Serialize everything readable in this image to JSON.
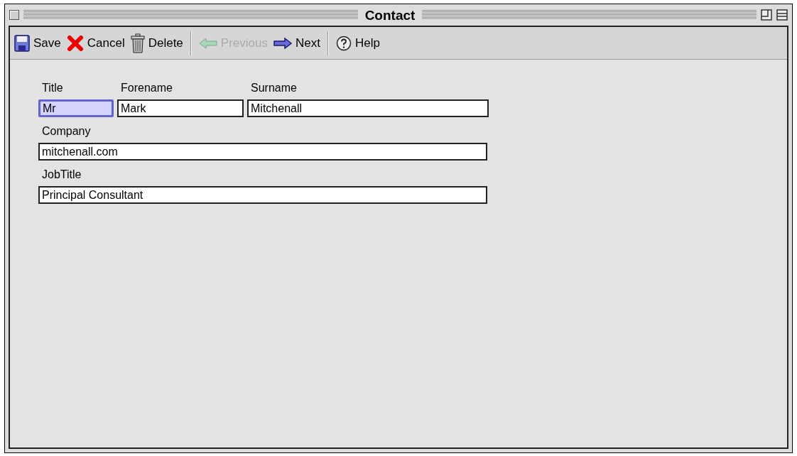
{
  "window": {
    "title": "Contact"
  },
  "toolbar": [
    {
      "kind": "save",
      "label": "Save",
      "disabled": false
    },
    {
      "kind": "cancel",
      "label": "Cancel",
      "disabled": false
    },
    {
      "kind": "delete",
      "label": "Delete",
      "disabled": false
    },
    {
      "kind": "separator"
    },
    {
      "kind": "previous",
      "label": "Previous",
      "disabled": true
    },
    {
      "kind": "next",
      "label": "Next",
      "disabled": false
    },
    {
      "kind": "separator"
    },
    {
      "kind": "help",
      "label": "Help",
      "disabled": false
    }
  ],
  "form": {
    "rows": [
      [
        {
          "label": "Title",
          "value": "Mr",
          "focused": true
        },
        {
          "label": "Forename",
          "value": "Mark",
          "focused": false
        },
        {
          "label": "Surname",
          "value": "Mitchenall",
          "focused": false
        }
      ],
      [
        {
          "label": "Company",
          "value": "mitchenall.com",
          "focused": false
        }
      ],
      [
        {
          "label": "JobTitle",
          "value": "Principal Consultant",
          "focused": false
        }
      ]
    ]
  }
}
